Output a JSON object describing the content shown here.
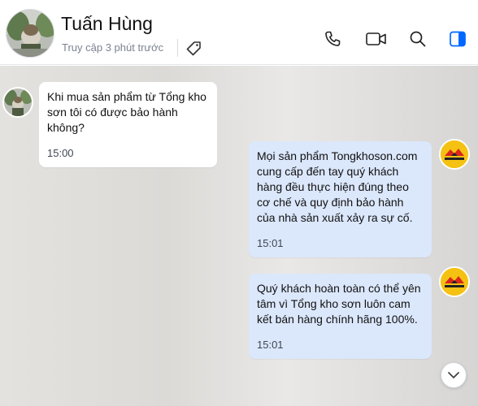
{
  "header": {
    "contact_name": "Tuấn Hùng",
    "last_seen": "Truy cập 3 phút trước",
    "icons": [
      "tag-icon",
      "phone-icon",
      "video-call-icon",
      "search-icon",
      "sidebar-toggle-icon"
    ],
    "accent_color": "#0068ff"
  },
  "messages": [
    {
      "direction": "incoming",
      "text": "Khi mua sản phẩm từ Tổng kho sơn tôi có được bảo hành không?",
      "time": "15:00"
    },
    {
      "direction": "outgoing",
      "text": "Mọi sản phẩm Tongkhoson.com cung cấp đến tay quý khách hàng đều thực hiện đúng theo cơ chế và quy định bảo hành của nhà sản xuất xảy ra sự cố.",
      "time": "15:01"
    },
    {
      "direction": "outgoing",
      "text": "Quý khách hoàn toàn có thể yên tâm vì Tổng kho sơn luôn cam kết bán hàng chính hãng 100%.",
      "time": "15:01"
    }
  ],
  "brand_avatar_text": "tongkhoson.com",
  "colors": {
    "outgoing_bubble": "#dbe7fb",
    "incoming_bubble": "#ffffff",
    "brand_yellow": "#f5c213",
    "brand_red": "#d9271c"
  }
}
